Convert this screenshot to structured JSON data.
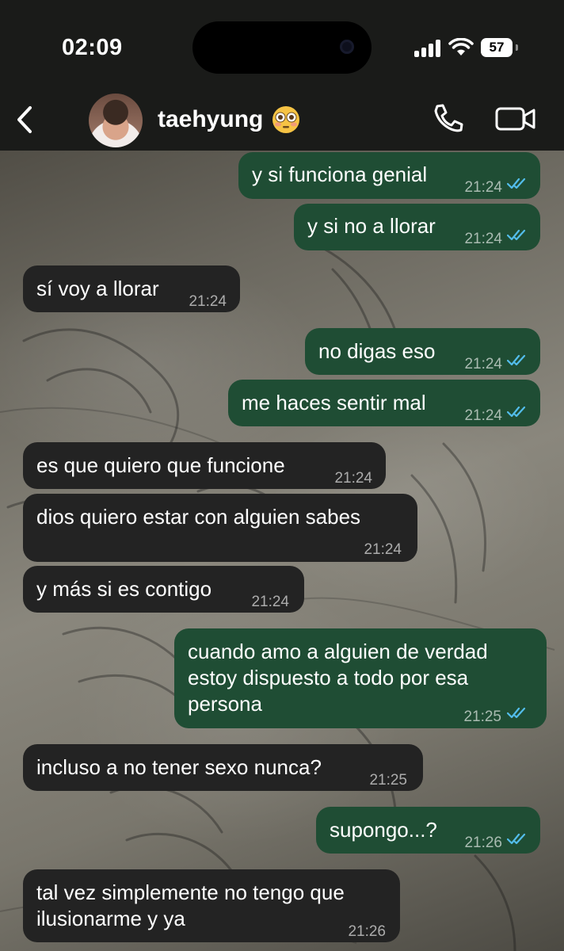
{
  "status_bar": {
    "time": "02:09",
    "battery_level": "57"
  },
  "header": {
    "contact_name": "taehyung",
    "contact_emoji": "flushed-face-emoji",
    "icons": [
      "chevron-left-icon",
      "phone-icon",
      "video-camera-icon"
    ]
  },
  "messages": [
    {
      "direction": "out",
      "text": "y si funciona genial",
      "time": "21:24",
      "status": "read"
    },
    {
      "direction": "out",
      "text": "y si no a llorar",
      "time": "21:24",
      "status": "read"
    },
    {
      "direction": "in",
      "text": "sí voy a llorar",
      "time": "21:24"
    },
    {
      "direction": "out",
      "text": "no digas eso",
      "time": "21:24",
      "status": "read"
    },
    {
      "direction": "out",
      "text": "me haces sentir mal",
      "time": "21:24",
      "status": "read"
    },
    {
      "direction": "in",
      "text": "es que quiero que funcione",
      "time": "21:24"
    },
    {
      "direction": "in",
      "text": "dios quiero estar con alguien sabes",
      "time": "21:24"
    },
    {
      "direction": "in",
      "text": "y más si es contigo",
      "time": "21:24"
    },
    {
      "direction": "out",
      "text": "cuando amo a alguien de verdad\nestoy dispuesto a todo por esa\npersona",
      "time": "21:25",
      "status": "read"
    },
    {
      "direction": "in",
      "text": "incluso a no tener sexo nunca?",
      "time": "21:25"
    },
    {
      "direction": "out",
      "text": "supongo...?",
      "time": "21:26",
      "status": "read"
    },
    {
      "direction": "in",
      "text": "tal vez simplemente no tengo que\nilusionarme y ya",
      "time": "21:26"
    }
  ],
  "colors": {
    "outgoing_bubble": "#1f4d34",
    "incoming_bubble": "#232323",
    "read_ticks": "#53bdeb",
    "header_bg": "#1a1b19"
  }
}
